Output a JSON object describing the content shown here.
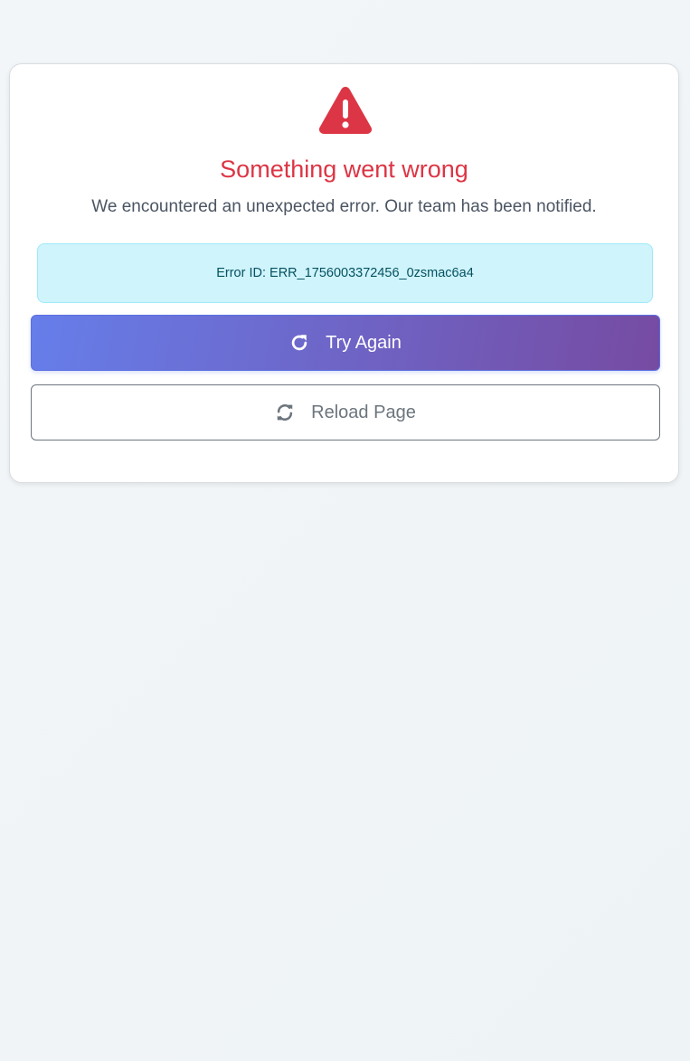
{
  "error": {
    "icon": "exclamation-triangle-icon",
    "title": "Something went wrong",
    "message": "We encountered an unexpected error. Our team has been notified.",
    "error_id_text": "Error ID: ERR_1756003372456_0zsmac6a4"
  },
  "actions": {
    "try_again": {
      "label": "Try Again",
      "icon": "redo-icon"
    },
    "reload": {
      "label": "Reload Page",
      "icon": "sync-icon"
    }
  },
  "colors": {
    "danger": "#dc3545",
    "info_bg": "#cff4fc",
    "info_text": "#055160",
    "gradient_start": "#667eea",
    "gradient_end": "#764ba2",
    "secondary": "#6c757d"
  }
}
